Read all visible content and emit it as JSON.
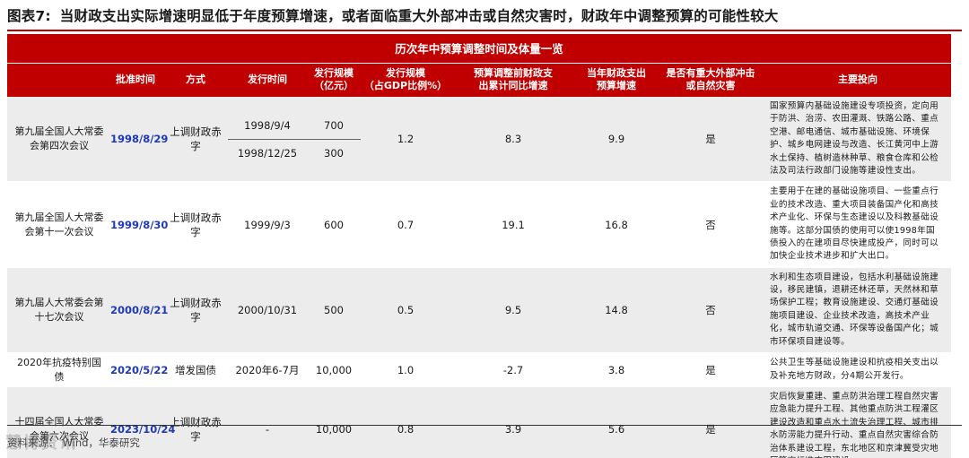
{
  "figure": {
    "number": "图表7:",
    "title": "当财政支出实际增速明显低于年度预算增速，或者面临重大外部冲击或自然灾害时，财政年中调整预算的可能性较大"
  },
  "table": {
    "banner": "历次年中预算调整时间及体量一览",
    "headers": {
      "meeting": "",
      "approval_date": "批准时间",
      "method": "方式",
      "issue_date": "发行时间",
      "scale": "发行规模\n（亿元）",
      "scale_gdp": "发行规模\n（占GDP比例%）",
      "pre_growth": "预算调整前财政支\n出累计同比增速",
      "budget_growth": "当年财政支出\n预算增速",
      "shock": "是否有重大外部冲击\n或自然灾害",
      "direction": "主要投向"
    },
    "rows": [
      {
        "meeting": "第九届全国人大常委会第四次会议",
        "approval_date": "1998/8/29",
        "method": "上调财政赤字",
        "issue_date_1": "1998/9/4",
        "scale_1": "700",
        "issue_date_2": "1998/12/25",
        "scale_2": "300",
        "scale_gdp": "1.2",
        "pre_growth": "8.3",
        "budget_growth": "9.9",
        "shock": "是",
        "direction": "国家预算内基础设施建设专项投资，定向用于防洪、治涝、农田灌溉、铁路公路、重点空港、邮电通信、城市基础设施、环境保护、城乡电网建设与改造、长江黄河中上游水土保持、植树造林种草、粮食仓库和公检法及司法行政部门设施等建设性支出。"
      },
      {
        "meeting": "第九届全国人大常委会第十一次会议",
        "approval_date": "1999/8/30",
        "method": "上调财政赤字",
        "issue_date": "1999/9/3",
        "scale": "600",
        "scale_gdp": "0.7",
        "pre_growth": "19.1",
        "budget_growth": "16.8",
        "shock": "否",
        "direction": "主要用于在建的基础设施项目、一些重点行业的技术改造、重大项目装备国产化和高技术产业化、环保与生态建设以及科教基础设施等。这部分国债的使用可以使1998年国债投入的在建项目尽快建成投产，同时可以加快企业技术进步和扩大出口。"
      },
      {
        "meeting": "第九届人大常委会第十七次会议",
        "approval_date": "2000/8/21",
        "method": "上调财政赤字",
        "issue_date": "2000/10/31",
        "scale": "500",
        "scale_gdp": "0.5",
        "pre_growth": "9.5",
        "budget_growth": "14.8",
        "shock": "否",
        "direction": "水利和生态项目建设，包括水利基础设施建设，移民建镇，退耕还林还草，天然林和草场保护工程；教育设施建设、交通灯基础设施项目建设、企业技术改造，高技术产业化，城市轨道交通、环保等设备国产化；城市环保项目建设等。"
      },
      {
        "meeting": "2020年抗疫特别国债",
        "approval_date": "2020/5/22",
        "method": "增发国债",
        "issue_date": "2020年6-7月",
        "scale": "10,000",
        "scale_gdp": "1.0",
        "pre_growth": "-2.7",
        "budget_growth": "3.8",
        "shock": "是",
        "direction": "公共卫生等基础设施建设和抗疫相关支出以及补充地方财政，分4期公开发行。"
      },
      {
        "meeting": "十四届全国人大常委会第六次会议",
        "approval_date": "2023/10/24",
        "method": "上调财政赤字",
        "issue_date": "-",
        "scale": "10,000",
        "scale_gdp": "0.8",
        "pre_growth": "3.9",
        "budget_growth": "5.6",
        "shock": "是",
        "direction": "灾后恢复重建、重点防洪治理工程自然灾害应急能力提升工程、其他重点防洪工程灌区建设改造和重点水土流失治理工程、城市排水防涝能力提升行动、重点自然灾害综合防治体系建设工程，东北地区和京津冀受灾地区等高标准农田建设。"
      }
    ]
  },
  "source": {
    "label": "资料来源：",
    "text": "Wind，华泰研究"
  },
  "watermark": "慧博资讯"
}
